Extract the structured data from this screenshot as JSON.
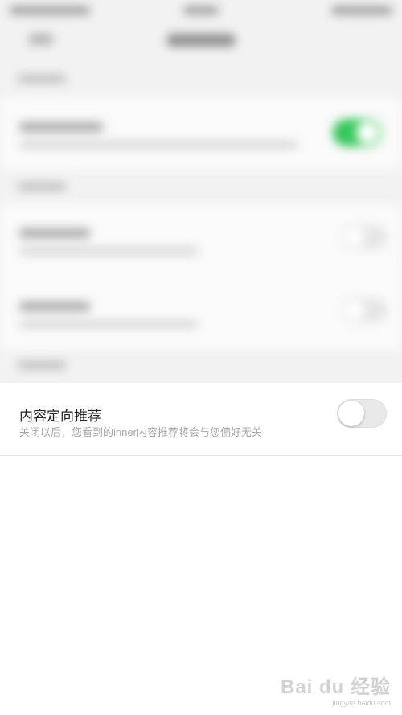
{
  "content_recommendation": {
    "title": "内容定向推荐",
    "subtitle": "关闭以后，您看到的inner内容推荐将会与您偏好无关",
    "toggle_state": "off"
  },
  "colors": {
    "toggle_on": "#35c759",
    "toggle_off": "#e9e9e9",
    "background": "#f2f2f2"
  },
  "watermark": {
    "brand": "Bai du 经验",
    "url": "jingyan.baidu.com"
  }
}
